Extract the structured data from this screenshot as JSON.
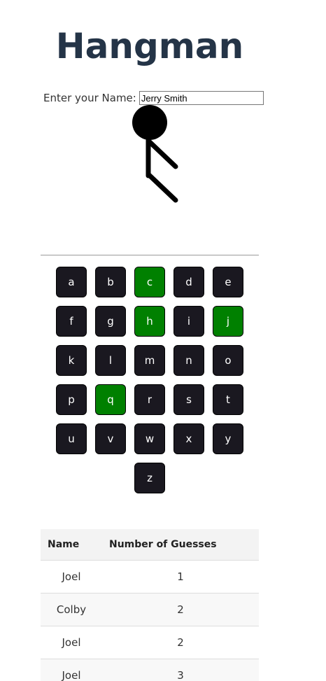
{
  "header": {
    "title": "Hangman"
  },
  "player": {
    "name_label": "Enter your Name:",
    "name_value": "Jerry Smith"
  },
  "keyboard": {
    "rows": [
      [
        {
          "letter": "a",
          "state": "unused"
        },
        {
          "letter": "b",
          "state": "unused"
        },
        {
          "letter": "c",
          "state": "correct"
        },
        {
          "letter": "d",
          "state": "unused"
        },
        {
          "letter": "e",
          "state": "unused"
        }
      ],
      [
        {
          "letter": "f",
          "state": "unused"
        },
        {
          "letter": "g",
          "state": "unused"
        },
        {
          "letter": "h",
          "state": "correct"
        },
        {
          "letter": "i",
          "state": "unused"
        },
        {
          "letter": "j",
          "state": "correct"
        }
      ],
      [
        {
          "letter": "k",
          "state": "unused"
        },
        {
          "letter": "l",
          "state": "unused"
        },
        {
          "letter": "m",
          "state": "unused"
        },
        {
          "letter": "n",
          "state": "unused"
        },
        {
          "letter": "o",
          "state": "unused"
        }
      ],
      [
        {
          "letter": "p",
          "state": "unused"
        },
        {
          "letter": "q",
          "state": "correct"
        },
        {
          "letter": "r",
          "state": "unused"
        },
        {
          "letter": "s",
          "state": "unused"
        },
        {
          "letter": "t",
          "state": "unused"
        }
      ],
      [
        {
          "letter": "u",
          "state": "unused"
        },
        {
          "letter": "v",
          "state": "unused"
        },
        {
          "letter": "w",
          "state": "unused"
        },
        {
          "letter": "x",
          "state": "unused"
        },
        {
          "letter": "y",
          "state": "unused"
        }
      ],
      [
        {
          "letter": "z",
          "state": "unused"
        }
      ]
    ],
    "colors": {
      "unused": "#1a1820",
      "correct": "#008000"
    }
  },
  "scoreboard": {
    "headers": [
      "Name",
      "Number of Guesses"
    ],
    "rows": [
      [
        "Joel",
        "1"
      ],
      [
        "Colby",
        "2"
      ],
      [
        "Joel",
        "2"
      ],
      [
        "Joel",
        "3"
      ]
    ]
  },
  "hangman_figure": {
    "parts_drawn": [
      "head",
      "body",
      "left-arm",
      "left-leg"
    ]
  }
}
